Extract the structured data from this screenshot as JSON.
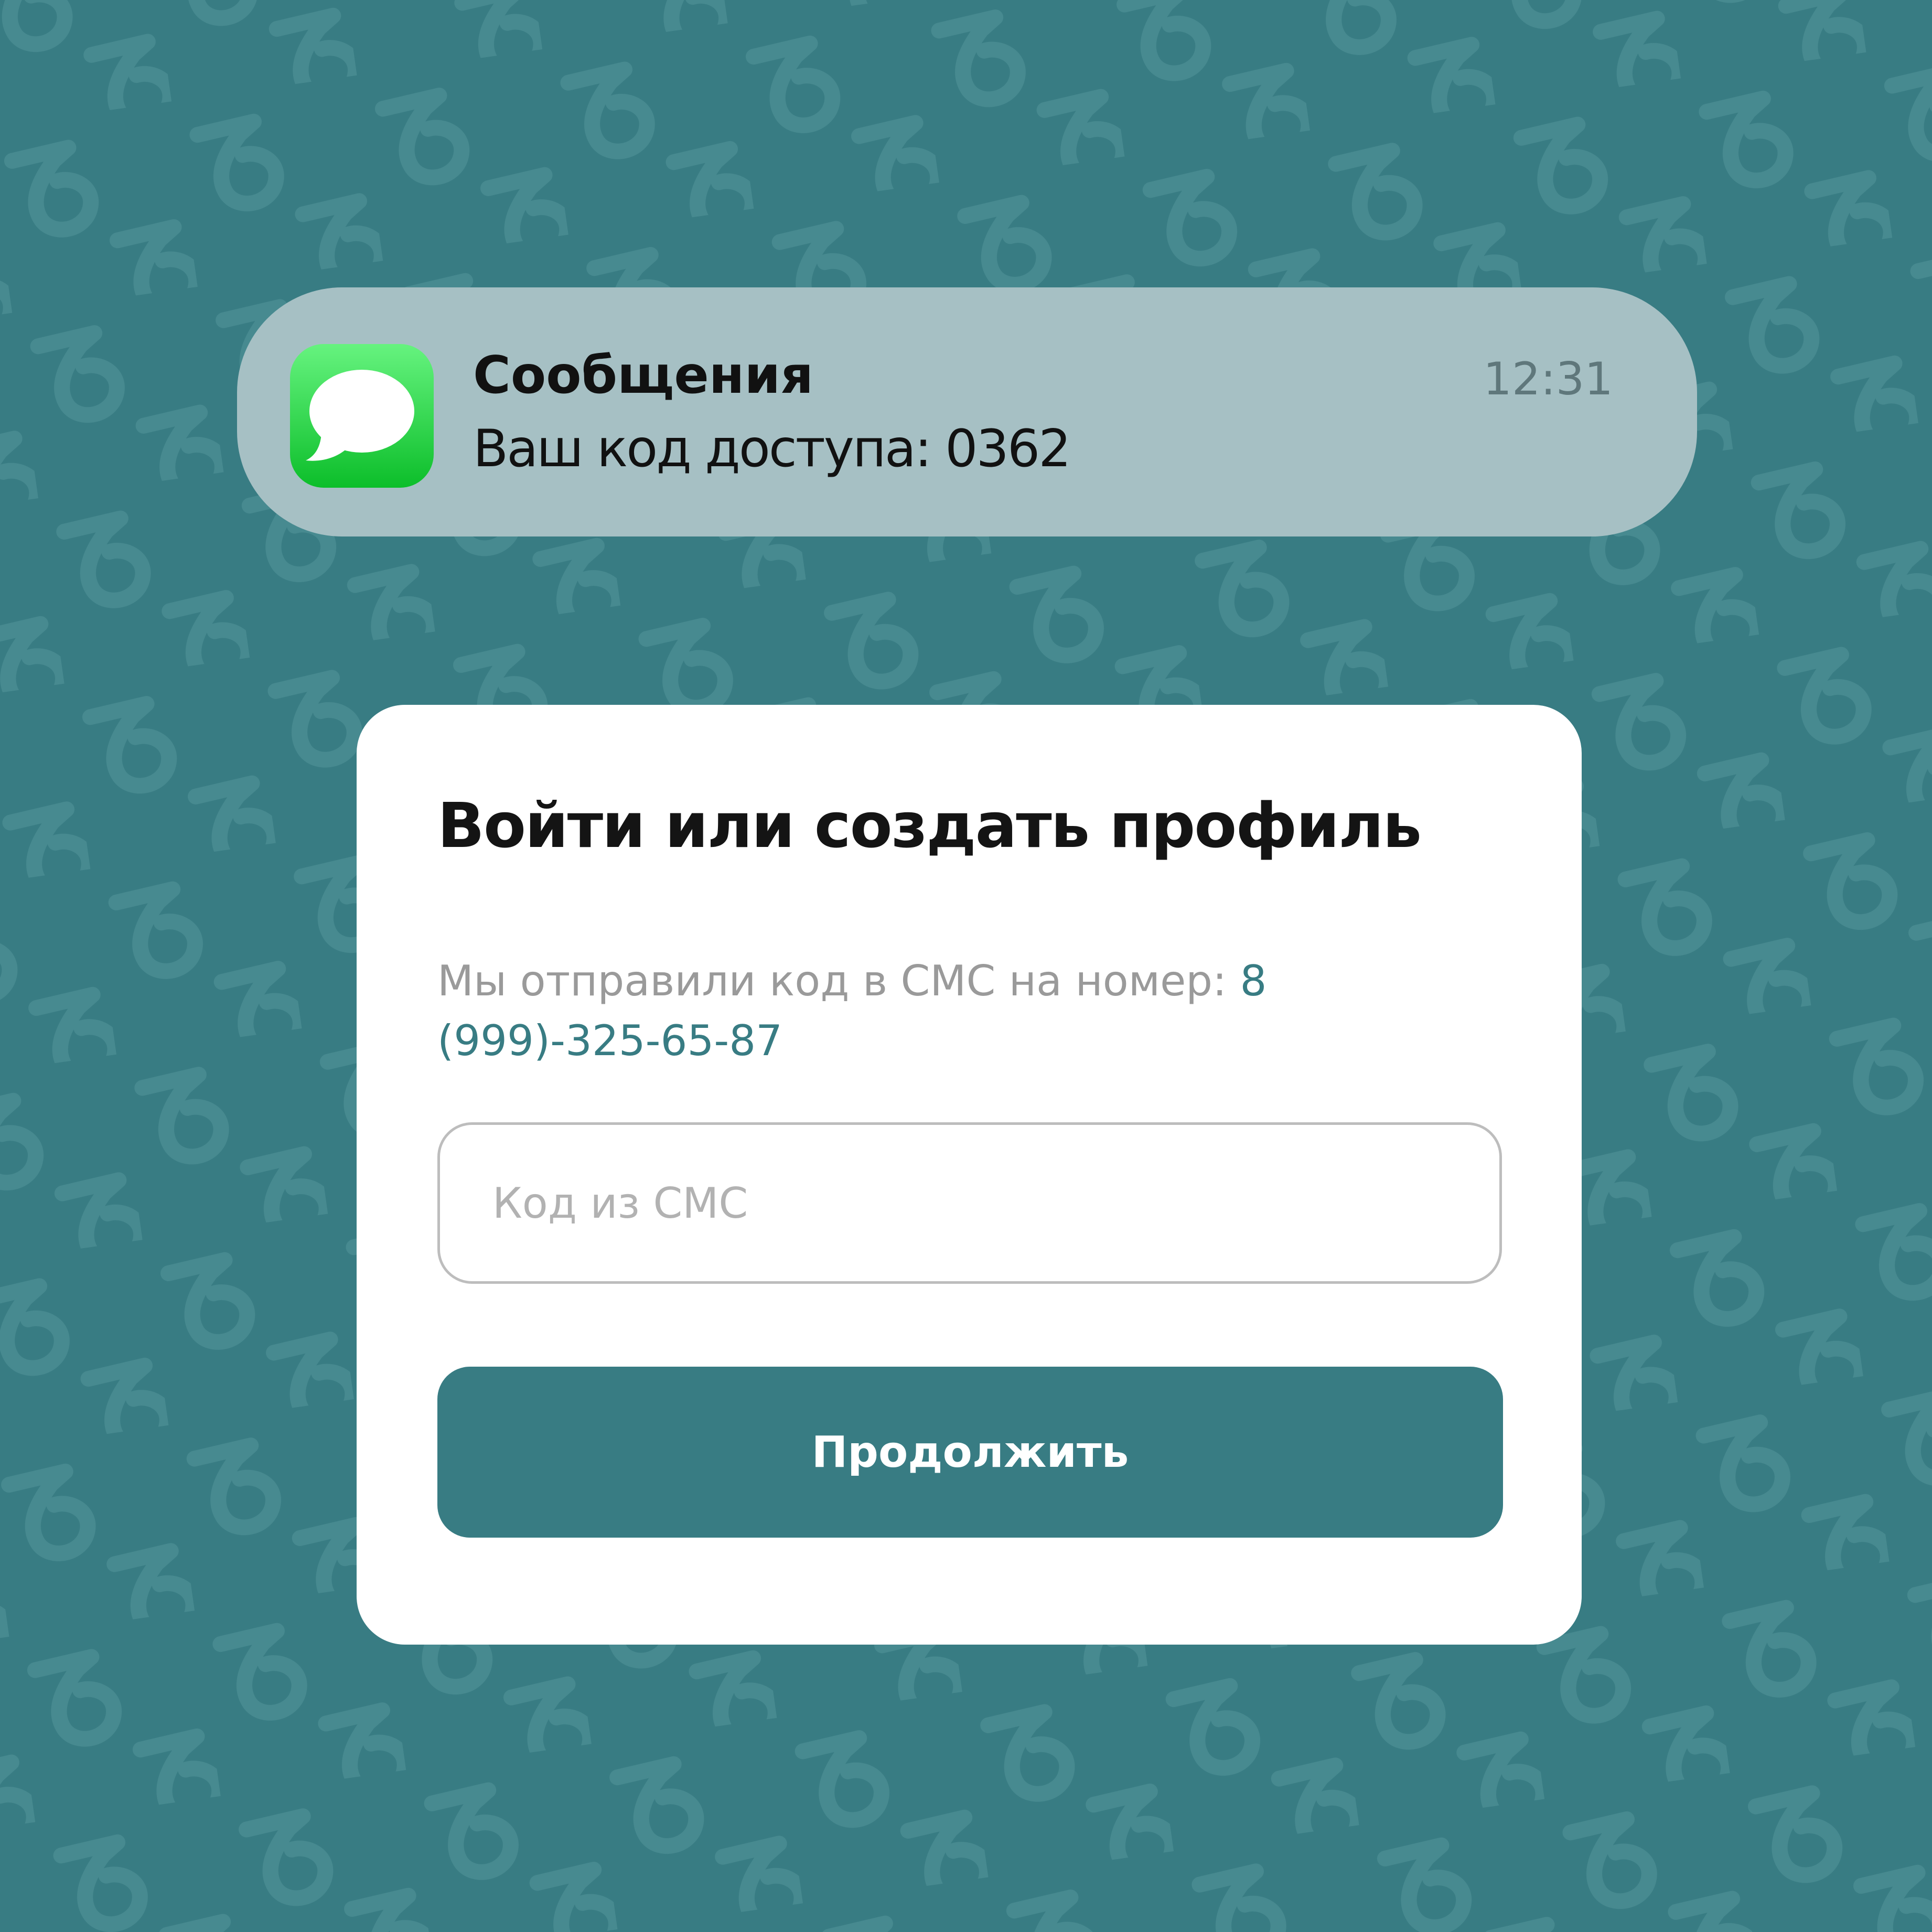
{
  "colors": {
    "background": "#387C83",
    "notification_background": "#A6C0C4",
    "card_background": "#FFFFFF",
    "accent": "#387C83",
    "messages_icon_green": "#1FD23F"
  },
  "notification": {
    "app_icon": "messages-speech-bubble-icon",
    "app_name": "Сообщения",
    "time": "12:31",
    "body": "Ваш код доступа: 0362"
  },
  "login": {
    "title": "Войти или создать профиль",
    "subtitle_text": "Мы отправили код в СМС на номер: ",
    "phone": "8 (999)-325-65-87",
    "code_input": {
      "placeholder": "Код из СМС",
      "value": ""
    },
    "continue_label": "Продолжить"
  }
}
